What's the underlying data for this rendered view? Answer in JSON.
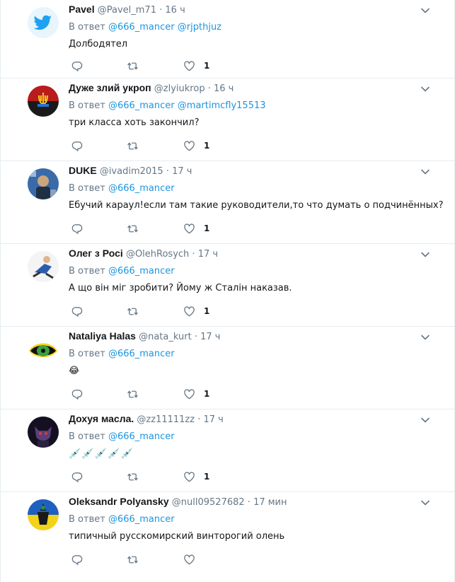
{
  "reply_prefix": "В ответ",
  "icons": {
    "reply": "reply-icon",
    "retweet": "retweet-icon",
    "like": "heart-icon",
    "caret": "chevron-down-icon"
  },
  "colors": {
    "mention": "#1b95e0",
    "muted": "#657786",
    "text": "#14171a",
    "border": "#e6ecf0"
  },
  "tweets": [
    {
      "name": "Pavel",
      "handle": "@Pavel_m71",
      "time": "16 ч",
      "reply_to": [
        "@666_mancer",
        "@rjpthjuz"
      ],
      "text": "Долбодятел",
      "likes": "1"
    },
    {
      "name": "Дуже злий укроп",
      "handle": "@zlyiukrop",
      "time": "16 ч",
      "reply_to": [
        "@666_mancer",
        "@martimcfly15513"
      ],
      "text": "три класса хоть закончил?",
      "likes": "1"
    },
    {
      "name": "DUKE",
      "handle": "@ivadim2015",
      "time": "17 ч",
      "reply_to": [
        "@666_mancer"
      ],
      "text": "Ебучий караул!если там такие руководители,то что думать о подчинённых?",
      "likes": "1"
    },
    {
      "name": "Олег з Росі",
      "handle": "@OlehRosych",
      "time": "17 ч",
      "reply_to": [
        "@666_mancer"
      ],
      "text": "А що він міг зробити? Йому ж Сталін наказав.",
      "likes": "1"
    },
    {
      "name": "Nataliya Halas",
      "handle": "@nata_kurt",
      "time": "17 ч",
      "reply_to": [
        "@666_mancer"
      ],
      "text": "😂",
      "likes": "1"
    },
    {
      "name": "Дохуя масла.",
      "handle": "@zz11111zz",
      "time": "17 ч",
      "reply_to": [
        "@666_mancer"
      ],
      "text": "💉💉💉💉💉",
      "likes": "1"
    },
    {
      "name": "Oleksandr Polyansky",
      "handle": "@null09527682",
      "time": "17 мин",
      "reply_to": [
        "@666_mancer"
      ],
      "text": "типичный русскомирский винторогий олень",
      "likes": ""
    }
  ]
}
